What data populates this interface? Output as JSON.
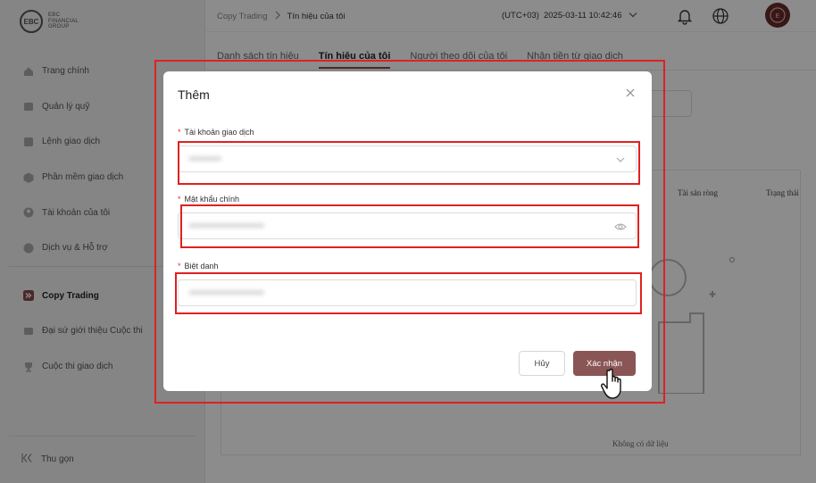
{
  "brand": {
    "mark": "EBC",
    "line1": "EBC",
    "line2": "FINANCIAL",
    "line3": "GROUP"
  },
  "sidebar": {
    "items": [
      {
        "label": "Trang chính",
        "icon": "home-icon"
      },
      {
        "label": "Quản lý quỹ",
        "icon": "fund-icon"
      },
      {
        "label": "Lệnh giao dịch",
        "icon": "order-icon"
      },
      {
        "label": "Phần mềm giao dịch",
        "icon": "software-icon"
      },
      {
        "label": "Tài khoản của tôi",
        "icon": "account-icon"
      },
      {
        "label": "Dịch vụ & Hỗ trợ",
        "icon": "support-icon"
      },
      {
        "label": "Copy Trading",
        "icon": "copy-trading-icon",
        "active": true
      },
      {
        "label": "Đại sứ giới thiệu Cuộc thi",
        "icon": "ambassador-icon"
      },
      {
        "label": "Cuộc thi giao dịch",
        "icon": "trophy-icon"
      }
    ],
    "collapse_label": "Thu gọn"
  },
  "header": {
    "breadcrumb_parent": "Copy Trading",
    "breadcrumb_current": "Tín hiệu của tôi",
    "timezone": "(UTC+03)",
    "datetime": "2025-03-11 10:42:46"
  },
  "main": {
    "tabs": [
      {
        "label": "Danh sách tín hiệu"
      },
      {
        "label": "Tín hiệu của tôi",
        "active": true
      },
      {
        "label": "Người theo dõi của tôi"
      },
      {
        "label": "Nhận tiền từ giao dịch"
      }
    ],
    "table_headers": [
      "Tài sản ròng",
      "Trạng thái"
    ],
    "empty_text": "Không có dữ liệu"
  },
  "modal": {
    "title": "Thêm",
    "fields": [
      {
        "label": "Tài khoản giao dịch",
        "value": "•••••••••",
        "type": "select"
      },
      {
        "label": "Mật khẩu chính",
        "value": "•••••••••••••••••••••",
        "type": "password"
      },
      {
        "label": "Biệt danh",
        "value": "•••••••••••••••••••••",
        "type": "text"
      }
    ],
    "cancel_label": "Hủy",
    "confirm_label": "Xác nhận"
  },
  "colors": {
    "accent": "#8a5555",
    "highlight": "#e02020",
    "required": "#e03030"
  }
}
